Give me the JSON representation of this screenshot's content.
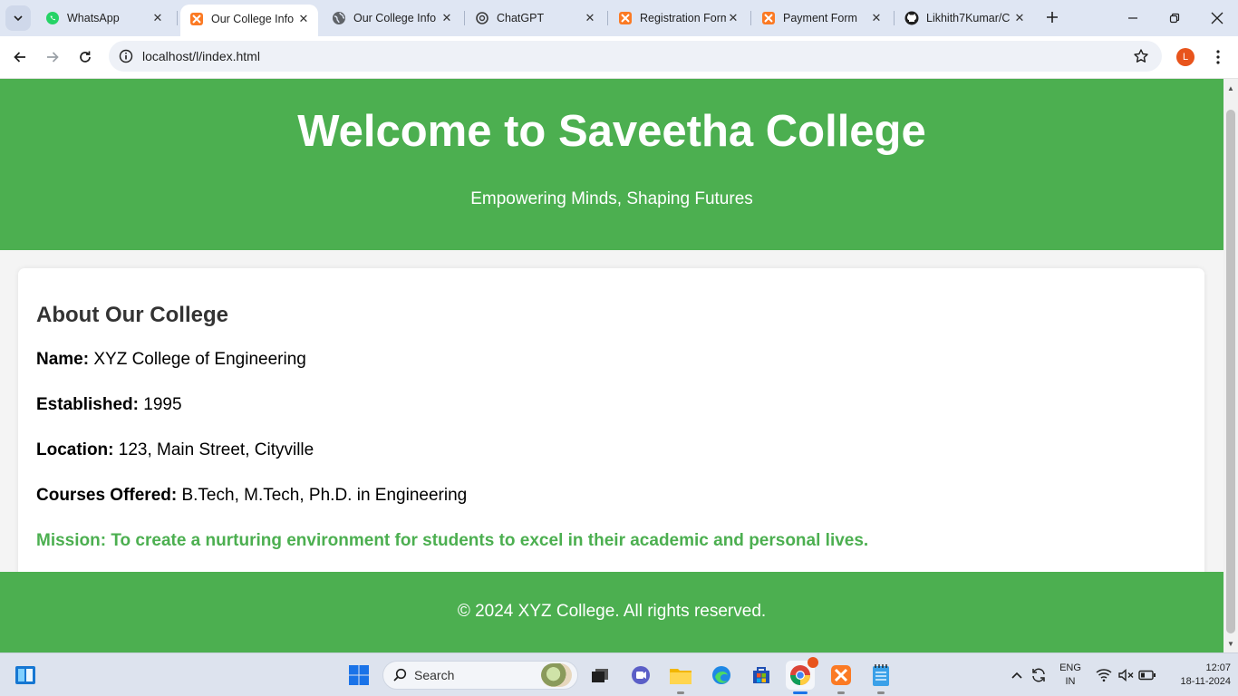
{
  "browser": {
    "tabs": [
      {
        "title": "WhatsApp",
        "icon": "whatsapp-icon",
        "active": false
      },
      {
        "title": "Our College Info",
        "icon": "xampp-icon",
        "active": true
      },
      {
        "title": "Our College Info",
        "icon": "globe-icon",
        "active": false
      },
      {
        "title": "ChatGPT",
        "icon": "chatgpt-icon",
        "active": false
      },
      {
        "title": "Registration Form",
        "icon": "xampp-icon",
        "active": false
      },
      {
        "title": "Payment Form",
        "icon": "xampp-icon",
        "active": false
      },
      {
        "title": "Likhith7Kumar/C",
        "icon": "github-icon",
        "active": false
      }
    ],
    "url": "localhost/l/index.html",
    "profile_initial": "L"
  },
  "page": {
    "header": {
      "title": "Welcome to Saveetha College",
      "tagline": "Empowering Minds, Shaping Futures"
    },
    "about": {
      "heading": "About Our College",
      "fields": [
        {
          "label": "Name:",
          "value": "XYZ College of Engineering"
        },
        {
          "label": "Established:",
          "value": "1995"
        },
        {
          "label": "Location:",
          "value": "123, Main Street, Cityville"
        },
        {
          "label": "Courses Offered:",
          "value": "B.Tech, M.Tech, Ph.D. in Engineering"
        }
      ],
      "mission": "Mission: To create a nurturing environment for students to excel in their academic and personal lives."
    },
    "footer": {
      "text": "© 2024 XYZ College. All rights reserved."
    }
  },
  "taskbar": {
    "search_label": "Search",
    "language": "ENG",
    "region": "IN",
    "time": "12:07",
    "date": "18-11-2024"
  },
  "colors": {
    "accent_green": "#4caf50",
    "tabstrip": "#dfe6f3",
    "taskbar": "#dde3ee"
  }
}
